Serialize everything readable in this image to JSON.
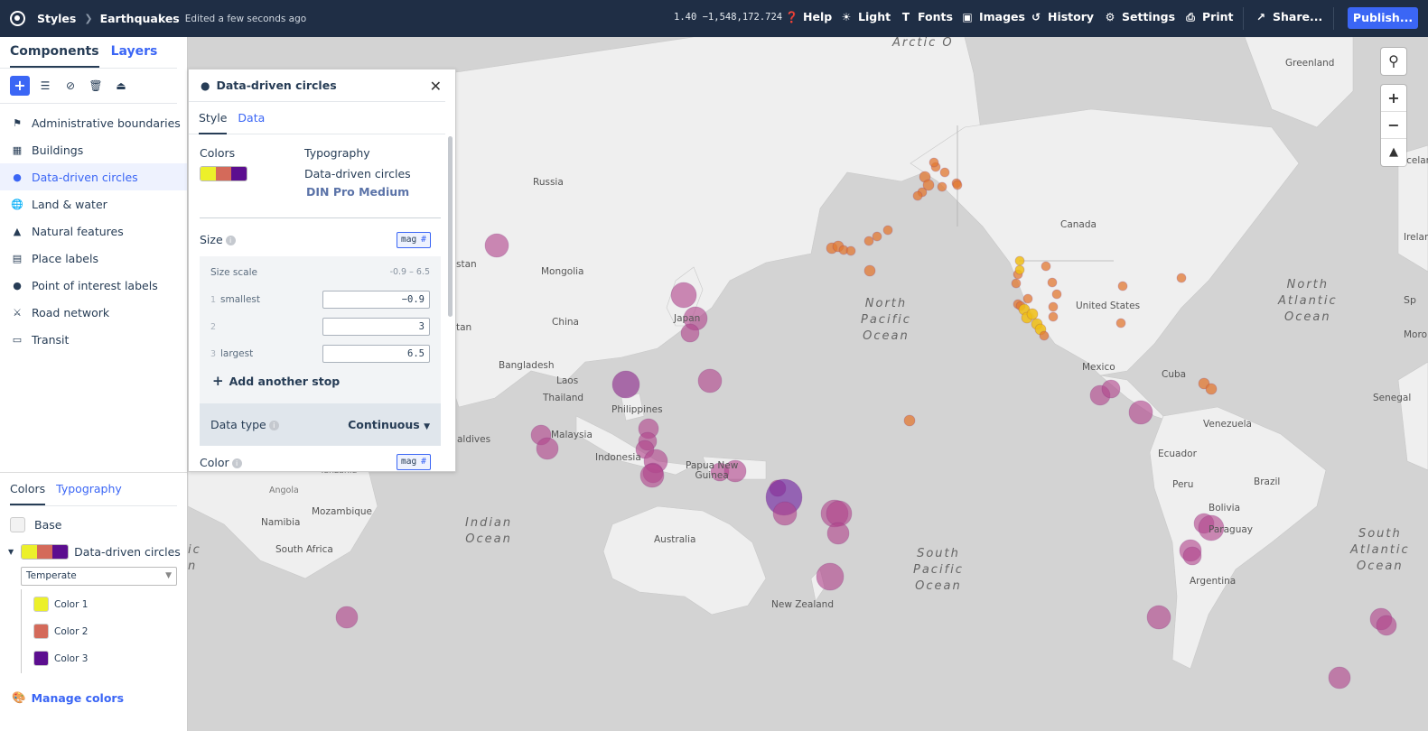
{
  "topbar": {
    "root": "Styles",
    "style_name": "Earthquakes",
    "edited": "Edited a few seconds ago",
    "coords": "1.40 −1,548,172.724",
    "buttons": {
      "help": "Help",
      "light": "Light",
      "fonts": "Fonts",
      "images": "Images",
      "history": "History",
      "settings": "Settings",
      "print": "Print",
      "share": "Share...",
      "publish": "Publish..."
    }
  },
  "sidebar": {
    "tabs": [
      "Components",
      "Layers"
    ],
    "layers": [
      {
        "label": "Administrative boundaries",
        "icon": "flag-icon"
      },
      {
        "label": "Buildings",
        "icon": "building-icon"
      },
      {
        "label": "Data-driven circles",
        "icon": "circles-icon"
      },
      {
        "label": "Land & water",
        "icon": "globe-icon"
      },
      {
        "label": "Natural features",
        "icon": "mountain-icon"
      },
      {
        "label": "Place labels",
        "icon": "place-icon"
      },
      {
        "label": "Point of interest labels",
        "icon": "pin-icon"
      },
      {
        "label": "Road network",
        "icon": "road-icon"
      },
      {
        "label": "Transit",
        "icon": "train-icon"
      }
    ],
    "bottom_tabs": [
      "Colors",
      "Typography"
    ],
    "base_label": "Base",
    "ddc_label": "Data-driven circles",
    "palette": "Temperate",
    "colors": [
      {
        "label": "Color 1",
        "hex": "#ecf02a"
      },
      {
        "label": "Color 2",
        "hex": "#d46a5a"
      },
      {
        "label": "Color 3",
        "hex": "#5c0e8f"
      }
    ],
    "manage_colors": "Manage colors"
  },
  "panel": {
    "title": "Data-driven circles",
    "tabs": [
      "Style",
      "Data"
    ],
    "colors_label": "Colors",
    "typography_label": "Typography",
    "typography_name": "Data-driven circles",
    "font": "DIN Pro Medium",
    "size_label": "Size",
    "size_field": "mag",
    "size_scale_label": "Size scale",
    "size_scale_range": "-0.9 – 6.5",
    "stops": [
      {
        "num": "1",
        "label": "smallest",
        "value": "−0.9"
      },
      {
        "num": "2",
        "label": "",
        "value": "3"
      },
      {
        "num": "3",
        "label": "largest",
        "value": "6.5"
      }
    ],
    "add_stop": "Add another stop",
    "data_type_label": "Data type",
    "data_type_value": "Continuous",
    "color_label": "Color",
    "color_field": "mag"
  },
  "map": {
    "labels": {
      "greenland": "Greenland",
      "russia": "Russia",
      "canada": "Canada",
      "mongolia": "Mongolia",
      "china": "China",
      "japan": "Japan",
      "us": "United States",
      "mexico": "Mexico",
      "cuba": "Cuba",
      "venezuela": "Venezuela",
      "ecuador": "Ecuador",
      "peru": "Peru",
      "bolivia": "Bolivia",
      "brazil": "Brazil",
      "paraguay": "Paraguay",
      "argentina": "Argentina",
      "australia": "Australia",
      "nz": "New Zealand",
      "indonesia": "Indonesia",
      "png": "Papua New\nGuinea",
      "philippines": "Philippines",
      "laos": "Laos",
      "thailand": "Thailand",
      "bangladesh": "Bangladesh",
      "malaysia": "Malaysia",
      "maldives": "aldives",
      "tanzania": "Tanzania",
      "angola": "Angola",
      "mozambique": "Mozambique",
      "namibia": "Namibia",
      "south_africa": "South Africa",
      "senegal": "Senegal",
      "iceland": "Icelan",
      "ireland": "Irelan",
      "morocco": "Moro",
      "stan": "stan",
      "tan": "tan",
      "arctic": "Arctic O",
      "ic": "ic",
      "n": "n",
      "sp": "Sp"
    },
    "oceans": {
      "npo": "North\nPacific\nOcean",
      "spo": "South\nPacific\nOcean",
      "io": "Indian\nOcean",
      "nao": "North\nAtlantic\nOcean",
      "sao": "South\nAtlantic\nOcean"
    }
  }
}
